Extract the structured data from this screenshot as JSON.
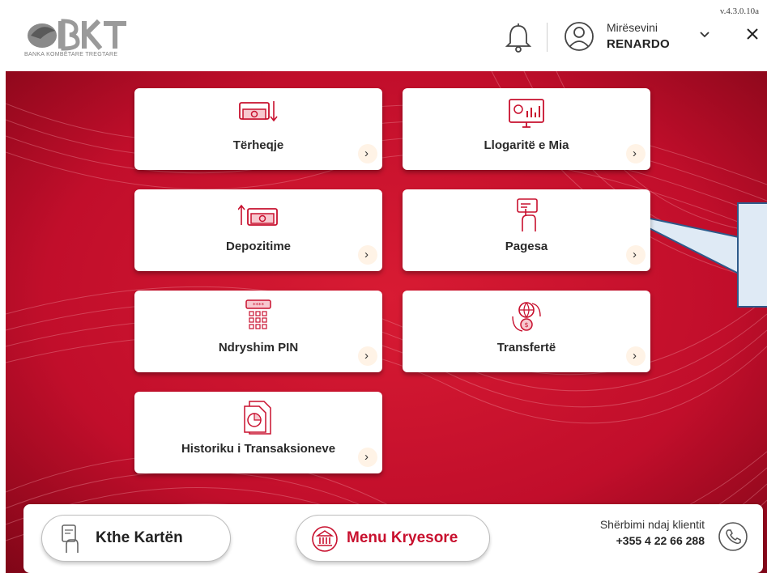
{
  "header": {
    "logo_caption": "BANKA KOMBËTARE TREGTARE",
    "logo_lettering": "BKT",
    "version": "v.4.3.0.10a",
    "welcome": "Mirësevini",
    "username": "RENARDO",
    "icons": [
      "bell-icon",
      "user-icon",
      "chevron-down-icon",
      "close-icon"
    ]
  },
  "tiles": [
    {
      "label": "Tërheqje",
      "icon": "cash-withdraw-icon"
    },
    {
      "label": "Llogaritë e Mia",
      "icon": "monitor-chart-icon"
    },
    {
      "label": "Depozitime",
      "icon": "cash-deposit-icon"
    },
    {
      "label": "Pagesa",
      "icon": "hand-card-icon"
    },
    {
      "label": "Ndryshim PIN",
      "icon": "pin-keypad-icon"
    },
    {
      "label": "Transfertë",
      "icon": "globe-transfer-icon"
    },
    {
      "label": "Historiku i Transaksioneve",
      "icon": "document-pie-icon"
    }
  ],
  "footer": {
    "return_card": "Kthe Kartën",
    "main_menu": "Menu Kryesore",
    "support_title": "Shërbimi ndaj klientit",
    "support_phone": "+355 4 22 66 288"
  },
  "colors": {
    "brand_red": "#c8102e",
    "tile_bg": "#ffffff",
    "arrow_bg": "#fff3e6",
    "callout_fill": "#dfeaf5",
    "callout_stroke": "#2e5a8a"
  }
}
